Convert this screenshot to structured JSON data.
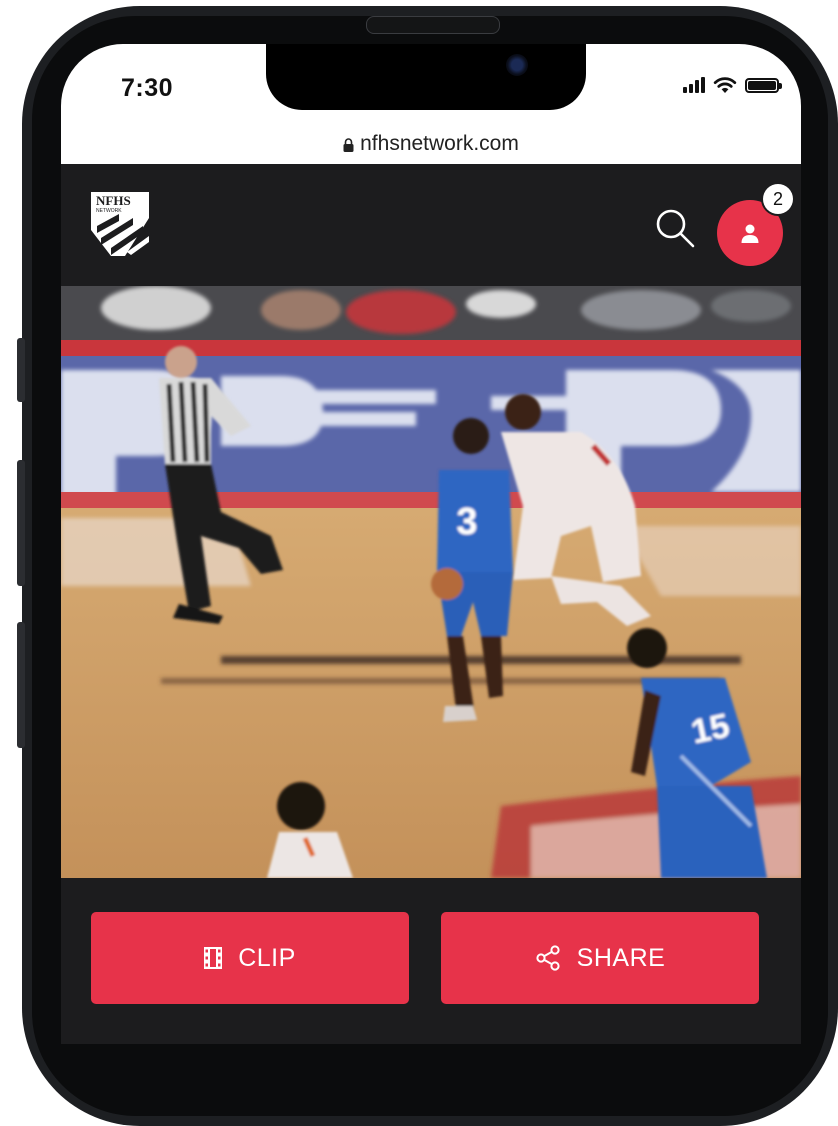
{
  "status_bar": {
    "time": "7:30",
    "icons": [
      "cellular-signal-icon",
      "wifi-icon",
      "battery-icon"
    ]
  },
  "browser": {
    "url": "nfhsnetwork.com",
    "icon": "lock-icon"
  },
  "header": {
    "logo_text_top": "NFHS",
    "logo_text_bottom": "NETWORK",
    "search_icon": "search-icon",
    "profile_icon": "user-icon",
    "notification_count": "2"
  },
  "video": {
    "jersey_numbers": [
      "3",
      "15"
    ]
  },
  "actions": {
    "clip_label": "CLIP",
    "clip_icon": "film-icon",
    "share_label": "SHARE",
    "share_icon": "share-icon"
  },
  "colors": {
    "accent": "#e7334a",
    "header_bg": "#1c1c1e",
    "screen_bg": "#ffffff"
  }
}
